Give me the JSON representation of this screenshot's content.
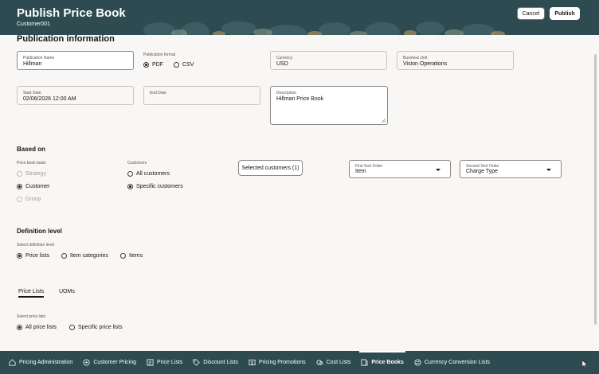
{
  "header": {
    "title": "Publish Price Book",
    "subtitle": "Customer001",
    "cancel_label": "Cancel",
    "publish_label": "Publish"
  },
  "publication": {
    "heading": "Publication information",
    "name_label": "Publication Name",
    "name_value": "Hillman",
    "format_label": "Publication format",
    "format_options": [
      "PDF",
      "CSV"
    ],
    "format_selected": "PDF",
    "currency_label": "Currency",
    "currency_value": "USD",
    "bu_label": "Business Unit",
    "bu_value": "Vision Operations",
    "start_label": "Start Date",
    "start_value": "02/06/2026 12:00 AM",
    "end_label": "End Date",
    "end_value": "",
    "desc_label": "Description",
    "desc_value": "Hillman Price Book"
  },
  "based_on": {
    "heading": "Based on",
    "basis_label": "Price book basis",
    "basis_options": [
      "Strategy",
      "Customer",
      "Group"
    ],
    "basis_selected": "Customer",
    "customers_label": "Customers",
    "customers_options": [
      "All customers",
      "Specific customers"
    ],
    "customers_selected": "Specific customers",
    "selected_customers_button": "Selected customers (1)",
    "first_sort_label": "First Sort Order",
    "first_sort_value": "Item",
    "second_sort_label": "Second Sort Order",
    "second_sort_value": "Charge Type"
  },
  "definition": {
    "heading": "Definition level",
    "select_label": "Select definition level",
    "options": [
      "Price lists",
      "Item categories",
      "Items"
    ],
    "selected": "Price lists"
  },
  "tabs": {
    "items": [
      "Price Lists",
      "UOMs"
    ],
    "active": "Price Lists"
  },
  "price_lists": {
    "select_label": "Select price lists",
    "options": [
      "All price lists",
      "Specific price lists"
    ],
    "selected": "All price lists"
  },
  "bottom_nav": {
    "items": [
      {
        "label": "Pricing Administration",
        "icon": "home-icon"
      },
      {
        "label": "Customer Pricing",
        "icon": "customer-pricing-icon"
      },
      {
        "label": "Price Lists",
        "icon": "price-list-icon"
      },
      {
        "label": "Discount Lists",
        "icon": "tag-icon"
      },
      {
        "label": "Pricing Promotions",
        "icon": "promotion-icon"
      },
      {
        "label": "Cost Lists",
        "icon": "cost-icon"
      },
      {
        "label": "Price Books",
        "icon": "price-book-icon"
      },
      {
        "label": "Currency Conversion Lists",
        "icon": "currency-icon"
      }
    ],
    "active": "Price Books"
  },
  "colors": {
    "header_bg": "#2d4b50",
    "page_bg": "#f8f7f5"
  }
}
